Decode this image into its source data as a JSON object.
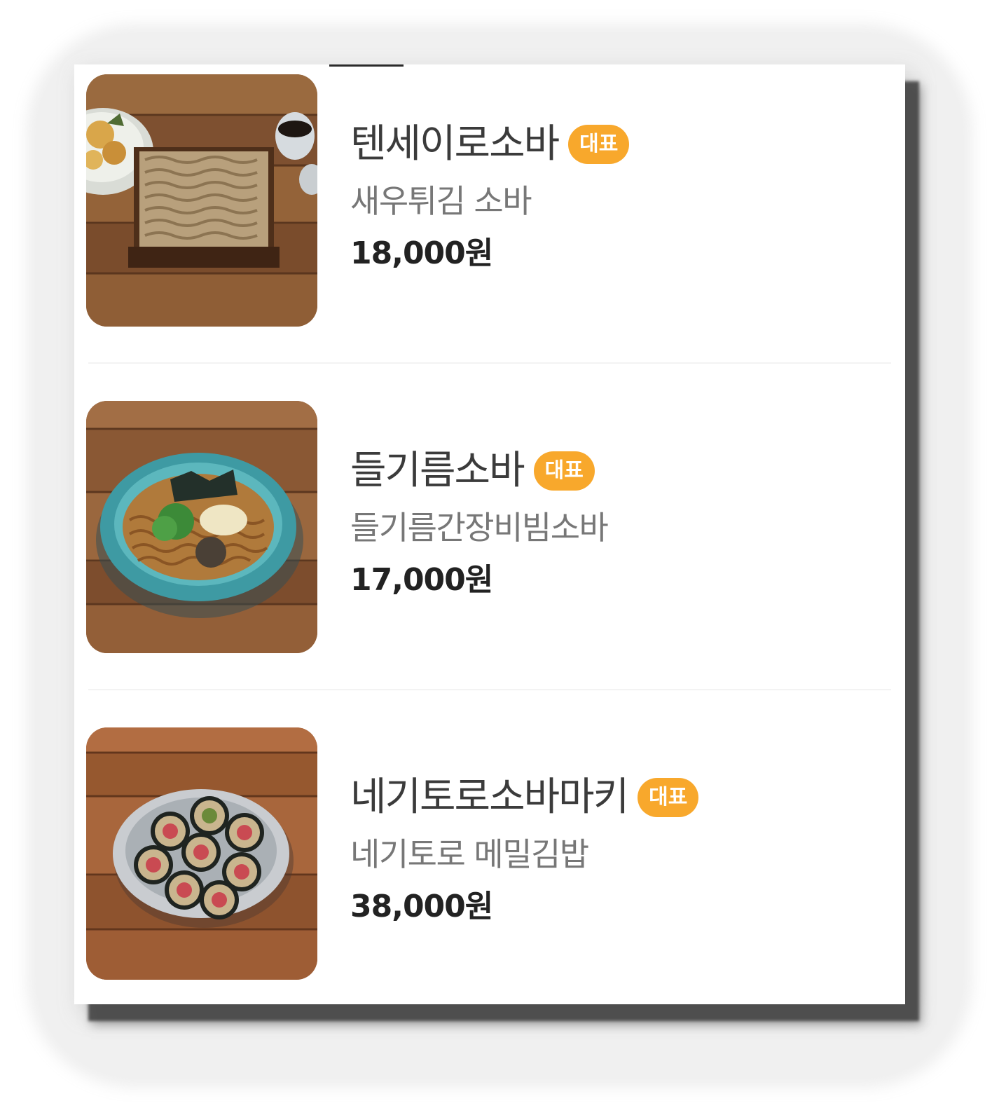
{
  "menu": {
    "items": [
      {
        "name": "텐세이로소바",
        "badge": "대표",
        "description": "새우튀김 소바",
        "price": "18,000원",
        "image": "zaru-soba-with-tempura-photo"
      },
      {
        "name": "들기름소바",
        "badge": "대표",
        "description": "들기름간장비빔소바",
        "price": "17,000원",
        "image": "perilla-oil-soba-bowl-photo"
      },
      {
        "name": "네기토로소바마키",
        "badge": "대표",
        "description": "네기토로 메밀김밥",
        "price": "38,000원",
        "image": "negitoro-soba-maki-plate-photo"
      }
    ]
  },
  "colors": {
    "badge": "#f8a82c",
    "name_text": "#3b3b3b",
    "description_text": "#777777",
    "price_text": "#222222"
  }
}
